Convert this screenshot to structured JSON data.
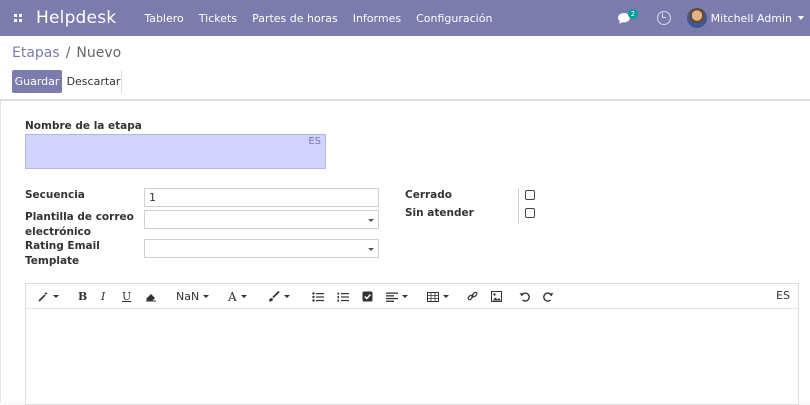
{
  "navbar": {
    "brand": "Helpdesk",
    "menu": [
      "Tablero",
      "Tickets",
      "Partes de horas",
      "Informes",
      "Configuración"
    ],
    "chat_badge": "2",
    "user_name": "Mitchell Admin"
  },
  "breadcrumb": {
    "parent": "Etapas",
    "separator": "/",
    "current": "Nuevo"
  },
  "buttons": {
    "save": "Guardar",
    "discard": "Descartar"
  },
  "form": {
    "name_label": "Nombre de la etapa",
    "name_value": "",
    "lang": "ES",
    "sequence_label": "Secuencia",
    "sequence_value": "1",
    "template_label_line1": "Plantilla de correo",
    "template_label_line2": "electrónico",
    "template_value": "",
    "rating_label_line1": "Rating Email",
    "rating_label_line2": "Template",
    "rating_value": "",
    "closed_label": "Cerrado",
    "closed_checked": false,
    "unattended_label": "Sin atender",
    "unattended_checked": false
  },
  "editor": {
    "font_size_value": "NaN",
    "font_color_letter": "A",
    "lang": "ES",
    "bold": "B",
    "italic": "I",
    "underline": "U"
  },
  "colors": {
    "navbar": "#7c7bad",
    "accent": "#7c7bad",
    "badge": "#00a09d",
    "name_field": "#d2d2ff"
  }
}
